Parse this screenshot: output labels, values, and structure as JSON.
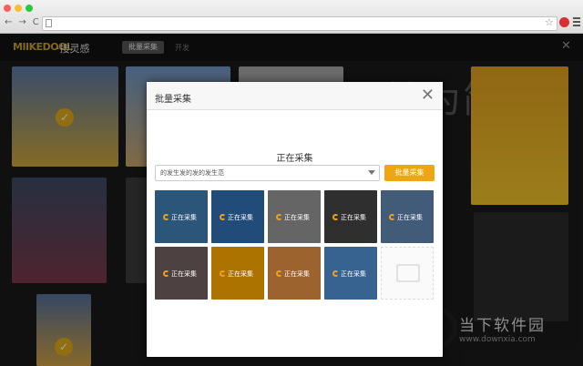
{
  "browser": {
    "nav_back": "←",
    "nav_forward": "→",
    "nav_reload": "C"
  },
  "app": {
    "logo": "MIIKEDOOL",
    "logo_sub": "·搜灵感",
    "top_button": "批量采集",
    "top_link": "开发",
    "background_text": "七繁为简",
    "close": "✕"
  },
  "dialog": {
    "title": "批量采集",
    "close": "✕",
    "status": "正在采集",
    "select_value": "的发生发的发的发生范",
    "primary_button": "批量采集",
    "items": [
      {
        "label": "正在采集",
        "color": "#3e78a8"
      },
      {
        "label": "正在采集",
        "color": "#2e6aa8"
      },
      {
        "label": "正在采集",
        "color": "#8c8c8c"
      },
      {
        "label": "正在采集",
        "color": "#424242"
      },
      {
        "label": "正在采集",
        "color": "#5b7ea8"
      },
      {
        "label": "正在采集",
        "color": "#6b5b5b"
      },
      {
        "label": "正在采集",
        "color": "#f0a000"
      },
      {
        "label": "正在采集",
        "color": "#d88a42"
      },
      {
        "label": "正在采集",
        "color": "#4b8ac8"
      },
      {
        "label": "",
        "color": ""
      }
    ]
  },
  "watermark": {
    "name": "当下软件园",
    "url": "www.downxia.com"
  }
}
